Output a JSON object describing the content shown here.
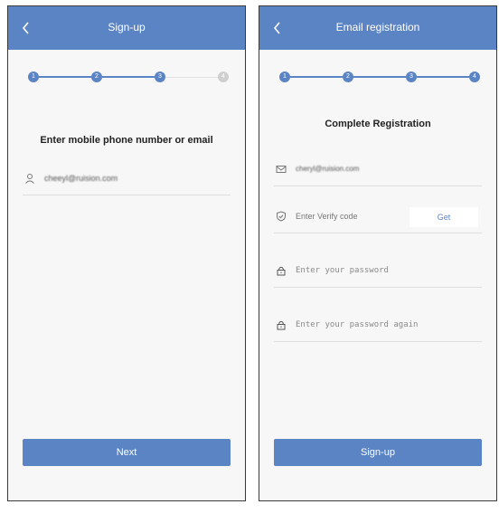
{
  "screens": [
    {
      "header_title": "Sign-up",
      "steps": [
        "1",
        "2",
        "3",
        "4"
      ],
      "active_steps": 3,
      "title": "Enter mobile phone number or email",
      "input": {
        "value": "cheeyl@ruision.com",
        "icon": "user-icon"
      },
      "primary_button": "Next"
    },
    {
      "header_title": "Email registration",
      "steps": [
        "1",
        "2",
        "3",
        "4"
      ],
      "active_steps": 4,
      "title": "Complete Registration",
      "fields": {
        "email": {
          "value": "cheryl@ruision.com",
          "icon": "mail-icon"
        },
        "verify": {
          "placeholder": "Enter Verify code",
          "button": "Get",
          "icon": "shield-check-icon"
        },
        "password": {
          "placeholder": "Enter your password",
          "icon": "lock-icon"
        },
        "password_again": {
          "placeholder": "Enter your password again",
          "icon": "lock-icon"
        }
      },
      "primary_button": "Sign-up"
    }
  ],
  "colors": {
    "accent": "#5b84c4",
    "background": "#f7f7f7",
    "divider": "#dedede"
  }
}
